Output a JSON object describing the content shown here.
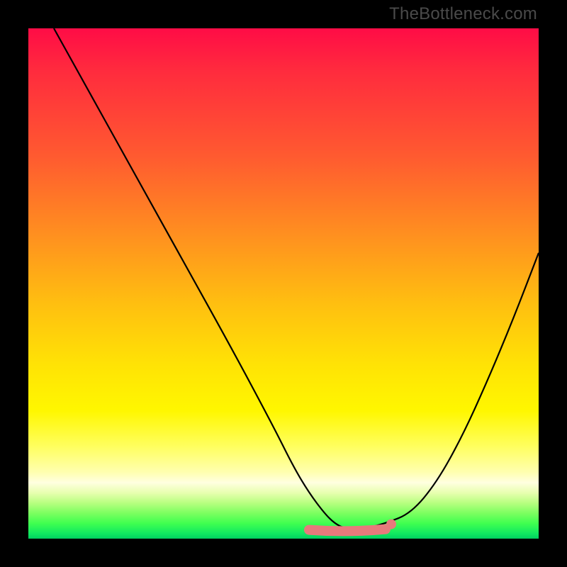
{
  "watermark": "TheBottleneck.com",
  "chart_data": {
    "type": "line",
    "title": "",
    "xlabel": "",
    "ylabel": "",
    "xlim": [
      0,
      100
    ],
    "ylim": [
      0,
      100
    ],
    "grid": false,
    "legend": false,
    "series": [
      {
        "name": "bottleneck-curve",
        "color": "#000000",
        "x": [
          5,
          10,
          20,
          30,
          40,
          48,
          52,
          55,
          58,
          60,
          62,
          66,
          70,
          75,
          80,
          85,
          90,
          95,
          100
        ],
        "y": [
          100,
          91,
          73,
          55,
          37,
          22,
          14,
          9,
          5,
          3,
          2,
          2,
          3,
          5,
          11,
          20,
          31,
          43,
          56
        ]
      }
    ],
    "highlight": {
      "name": "optimal-flat-region",
      "color": "#e77a7c",
      "x_range": [
        55,
        70
      ],
      "y": 2
    },
    "background_heatmap": {
      "orientation": "vertical",
      "stops": [
        {
          "y": 100,
          "color": "#ff0c46"
        },
        {
          "y": 75,
          "color": "#ff5a30"
        },
        {
          "y": 50,
          "color": "#ffbf10"
        },
        {
          "y": 25,
          "color": "#fff700"
        },
        {
          "y": 10,
          "color": "#ffffe0"
        },
        {
          "y": 3,
          "color": "#7cff60"
        },
        {
          "y": 0,
          "color": "#00d060"
        }
      ]
    }
  }
}
